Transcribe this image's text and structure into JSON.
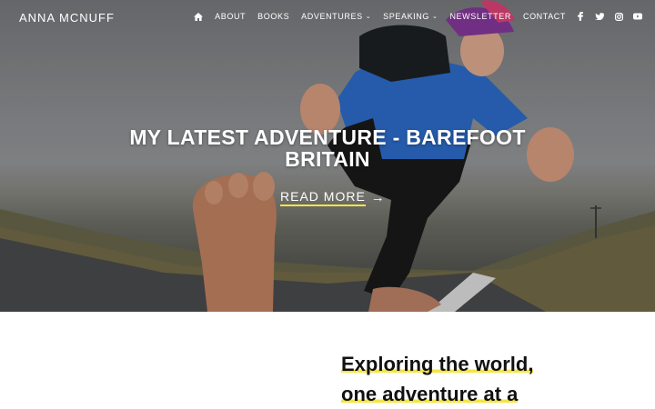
{
  "header": {
    "logo": "ANNA MCNUFF",
    "menu": [
      {
        "label": "ABOUT"
      },
      {
        "label": "BOOKS"
      },
      {
        "label": "ADVENTURES",
        "has_dropdown": true
      },
      {
        "label": "SPEAKING",
        "has_dropdown": true
      },
      {
        "label": "NEWSLETTER"
      },
      {
        "label": "CONTACT"
      }
    ],
    "icons": [
      "home-icon",
      "facebook-icon",
      "twitter-icon",
      "instagram-icon",
      "youtube-icon"
    ]
  },
  "hero": {
    "headline_line1": "MY LATEST ADVENTURE - BAREFOOT",
    "headline_line2": "BRITAIN",
    "cta_label": "READ MORE",
    "cta_arrow": "→"
  },
  "intro": {
    "line1": "Exploring the world,",
    "line2": "one adventure at a"
  },
  "colors": {
    "accent": "#f4e542",
    "nav_text": "#ffffff",
    "body_text": "#111111"
  }
}
